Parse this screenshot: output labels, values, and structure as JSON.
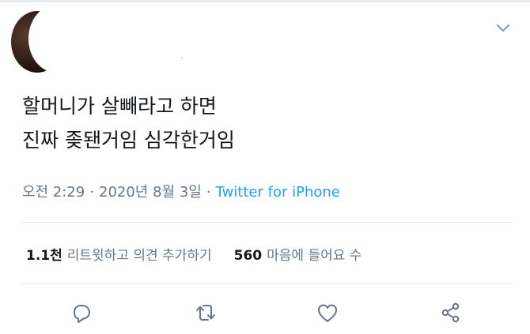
{
  "tweet": {
    "text_lines": [
      "할머니가 살빼라고 하면",
      "진짜 좆됀거임 심각한거임"
    ],
    "time": "오전 2:29",
    "date": "2020년 8월 3일",
    "separator": "·",
    "source": "Twitter for iPhone"
  },
  "stats": {
    "retweets_count": "1.1천",
    "retweets_label": "리트윗하고 의견 추가하기",
    "likes_count": "560",
    "likes_label": "마음에 들어요 수"
  },
  "actions": {
    "reply_icon": "reply-icon",
    "retweet_icon": "retweet-icon",
    "like_icon": "like-icon",
    "share_icon": "share-icon"
  },
  "colors": {
    "text": "#14171a",
    "secondary": "#657786",
    "accent": "#1da1f2",
    "divider": "#e6ecf0"
  }
}
